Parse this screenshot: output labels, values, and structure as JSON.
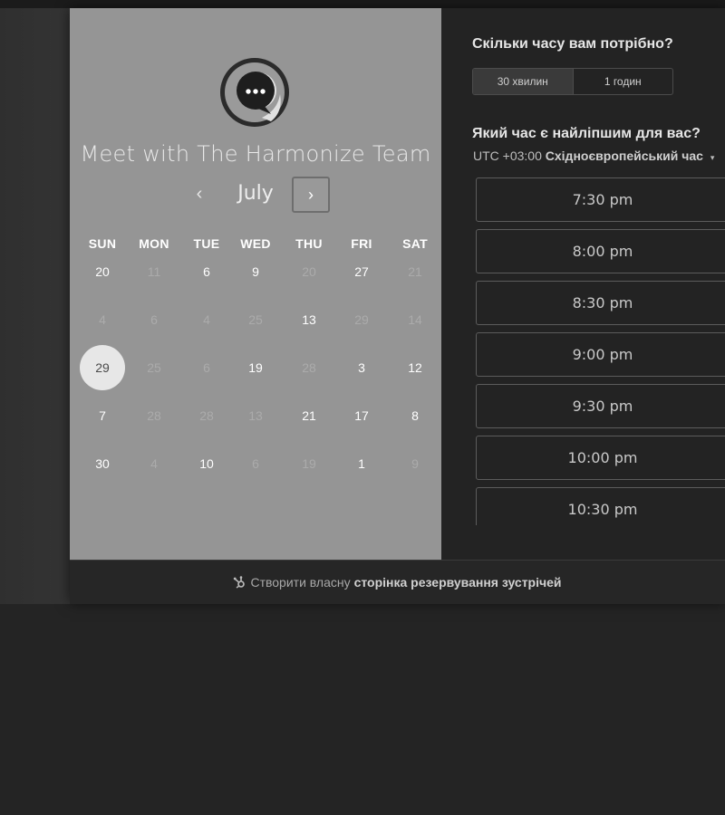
{
  "title": "Meet with The Harmonize Team",
  "calendar": {
    "month": "July",
    "prev_icon": "‹",
    "next_icon": "›",
    "weekdays": [
      "SUN",
      "MON",
      "TUE",
      "WED",
      "THU",
      "FRI",
      "SAT"
    ],
    "weeks": [
      [
        {
          "d": "20",
          "on": true
        },
        {
          "d": "11",
          "on": false
        },
        {
          "d": "6",
          "on": true
        },
        {
          "d": "9",
          "on": true
        },
        {
          "d": "20",
          "on": false
        },
        {
          "d": "27",
          "on": true
        },
        {
          "d": "21",
          "on": false
        }
      ],
      [
        {
          "d": "4",
          "on": false
        },
        {
          "d": "6",
          "on": false
        },
        {
          "d": "4",
          "on": false
        },
        {
          "d": "25",
          "on": false
        },
        {
          "d": "13",
          "on": true
        },
        {
          "d": "29",
          "on": false
        },
        {
          "d": "14",
          "on": false
        }
      ],
      [
        {
          "d": "29",
          "on": true,
          "selected": true
        },
        {
          "d": "25",
          "on": false
        },
        {
          "d": "6",
          "on": false
        },
        {
          "d": "19",
          "on": true
        },
        {
          "d": "28",
          "on": false
        },
        {
          "d": "3",
          "on": true
        },
        {
          "d": "12",
          "on": true
        }
      ],
      [
        {
          "d": "7",
          "on": true
        },
        {
          "d": "28",
          "on": false
        },
        {
          "d": "28",
          "on": false
        },
        {
          "d": "13",
          "on": false
        },
        {
          "d": "21",
          "on": true
        },
        {
          "d": "17",
          "on": true
        },
        {
          "d": "8",
          "on": true
        }
      ],
      [
        {
          "d": "30",
          "on": true
        },
        {
          "d": "4",
          "on": false
        },
        {
          "d": "10",
          "on": true
        },
        {
          "d": "6",
          "on": false
        },
        {
          "d": "19",
          "on": false
        },
        {
          "d": "1",
          "on": true
        },
        {
          "d": "9",
          "on": false
        }
      ]
    ]
  },
  "duration": {
    "question": "Скільки часу вам потрібно?",
    "options": [
      "30 хвилин",
      "1 годин"
    ],
    "selected": "30 хвилин"
  },
  "time": {
    "question": "Який час є найліпшим для вас?",
    "tz_prefix": "UTC +03:00",
    "tz_name": "Східноєвропейський час",
    "tz_caret": "▾",
    "slots": [
      "7:30 pm",
      "8:00 pm",
      "8:30 pm",
      "9:00 pm",
      "9:30 pm",
      "10:00 pm",
      "10:30 pm"
    ]
  },
  "footer": {
    "text": "Створити власну",
    "link": "сторінка резервування зустрічей"
  },
  "colors": {
    "left_panel": "#959595",
    "right_panel": "#232323",
    "selected_day": "#e7e7e7"
  }
}
